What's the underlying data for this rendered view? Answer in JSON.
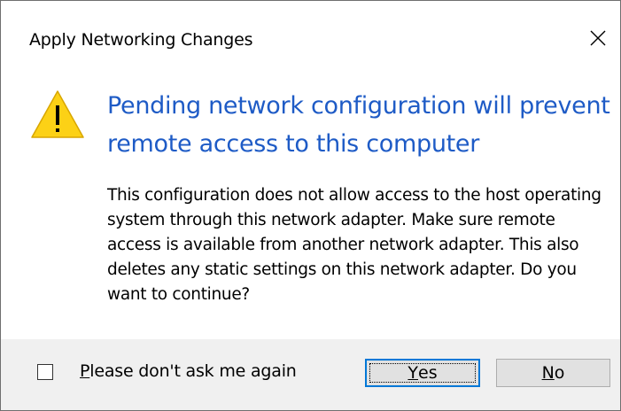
{
  "dialog": {
    "title": "Apply Networking Changes",
    "heading": "Pending network configuration will prevent remote access to this computer",
    "message": "This configuration does not allow access to the host operating system through this network adapter. Make sure remote access is available from another network adapter. This also deletes any static settings on this network adapter. Do you want to continue?"
  },
  "footer": {
    "checkbox_label_underlined": "P",
    "checkbox_label_rest": "lease don't ask me again",
    "checkbox_checked": false,
    "yes_underlined": "Y",
    "yes_rest": "es",
    "no_underlined": "N",
    "no_rest": "o"
  },
  "icons": {
    "warning": "warning-icon",
    "close": "close-icon"
  },
  "colors": {
    "heading": "#1e5bc6",
    "warning_fill": "#fcd116",
    "footer_bg": "#f0f0f0",
    "focus_border": "#0078d7"
  }
}
